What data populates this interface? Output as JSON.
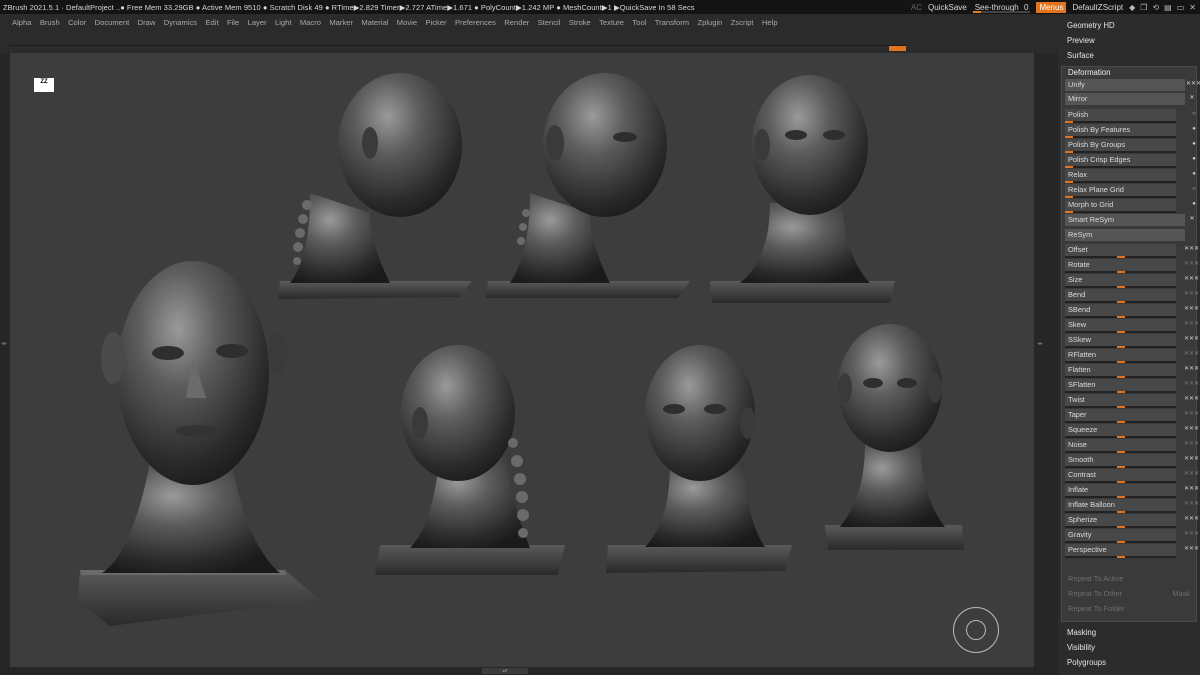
{
  "titlebar": {
    "status": "ZBrush 2021.5.1  ·  DefaultProject  ..● Free Mem 33.29GB ● Active Mem 9510 ● Scratch Disk 49 ●  RTime▶2.829 Timer▶2.727 ATime▶1.671 ● PolyCount▶1.242 MP  ● MeshCount▶1  ▶QuickSave In 58 Secs",
    "ac": "AC",
    "quicksave": "QuickSave",
    "seethrough": "See-through",
    "seethrough_value": "0",
    "menus": "Menus",
    "script": "DefaultZScript",
    "window_icons": [
      "◆",
      "❐",
      "⟲",
      "▤",
      "▭",
      "✕"
    ]
  },
  "menubar": [
    "Alpha",
    "Brush",
    "Color",
    "Document",
    "Draw",
    "Dynamics",
    "Edit",
    "File",
    "Layer",
    "Light",
    "Macro",
    "Marker",
    "Material",
    "Movie",
    "Picker",
    "Preferences",
    "Render",
    "Stencil",
    "Stroke",
    "Texture",
    "Tool",
    "Transform",
    "Zplugin",
    "Zscript",
    "Help"
  ],
  "canvas": {
    "logo": "ZZ",
    "arrow_left": "◂▸",
    "arrow_right": "◂▸",
    "bottom_arrows": "▴▾"
  },
  "palette": {
    "headers_top": [
      "Geometry HD",
      "Preview",
      "Surface"
    ],
    "deformation": {
      "title": "Deformation",
      "buttons": [
        {
          "label": "Unify"
        },
        {
          "label": "Mirror"
        }
      ],
      "polish_rows": [
        {
          "label": "Polish",
          "value": 0.0
        },
        {
          "label": "Polish By Features",
          "value": 0.0
        },
        {
          "label": "Polish By Groups",
          "value": 0.0
        },
        {
          "label": "Polish Crisp Edges",
          "value": 0.0
        },
        {
          "label": "Relax",
          "value": 0.0
        },
        {
          "label": "Relax Plane Grid",
          "value": 0.0
        },
        {
          "label": "Morph to Grid",
          "value": 0.0
        }
      ],
      "smart_resym": "Smart ReSym",
      "resym": "ReSym",
      "sliders": [
        {
          "label": "Offset",
          "value": 0.5
        },
        {
          "label": "Rotate",
          "value": 0.5
        },
        {
          "label": "Size",
          "value": 0.5
        },
        {
          "label": "Bend",
          "value": 0.5
        },
        {
          "label": "SBend",
          "value": 0.5
        },
        {
          "label": "Skew",
          "value": 0.5
        },
        {
          "label": "SSkew",
          "value": 0.5
        },
        {
          "label": "RFlatten",
          "value": 0.5
        },
        {
          "label": "Flatten",
          "value": 0.5
        },
        {
          "label": "SFlatten",
          "value": 0.5
        },
        {
          "label": "Twist",
          "value": 0.5
        },
        {
          "label": "Taper",
          "value": 0.5
        },
        {
          "label": "Squeeze",
          "value": 0.5
        },
        {
          "label": "Noise",
          "value": 0.5
        },
        {
          "label": "Smooth",
          "value": 0.5
        },
        {
          "label": "Contrast",
          "value": 0.5
        },
        {
          "label": "Inflate",
          "value": 0.5
        },
        {
          "label": "Inflate Balloon",
          "value": 0.5
        },
        {
          "label": "Spherize",
          "value": 0.5
        },
        {
          "label": "Gravity",
          "value": 0.5
        },
        {
          "label": "Perspective",
          "value": 0.5
        }
      ],
      "repeat_active": "Repeat To Active",
      "repeat_other": "Repeat To Other",
      "mask": "Mask",
      "repeat_folder": "Repeat To Folder"
    },
    "headers_bottom": [
      "Masking",
      "Visibility",
      "Polygroups"
    ]
  },
  "colors": {
    "accent": "#e2741f",
    "canvas": "#3d3d3d",
    "panel": "#2c2c2c"
  }
}
